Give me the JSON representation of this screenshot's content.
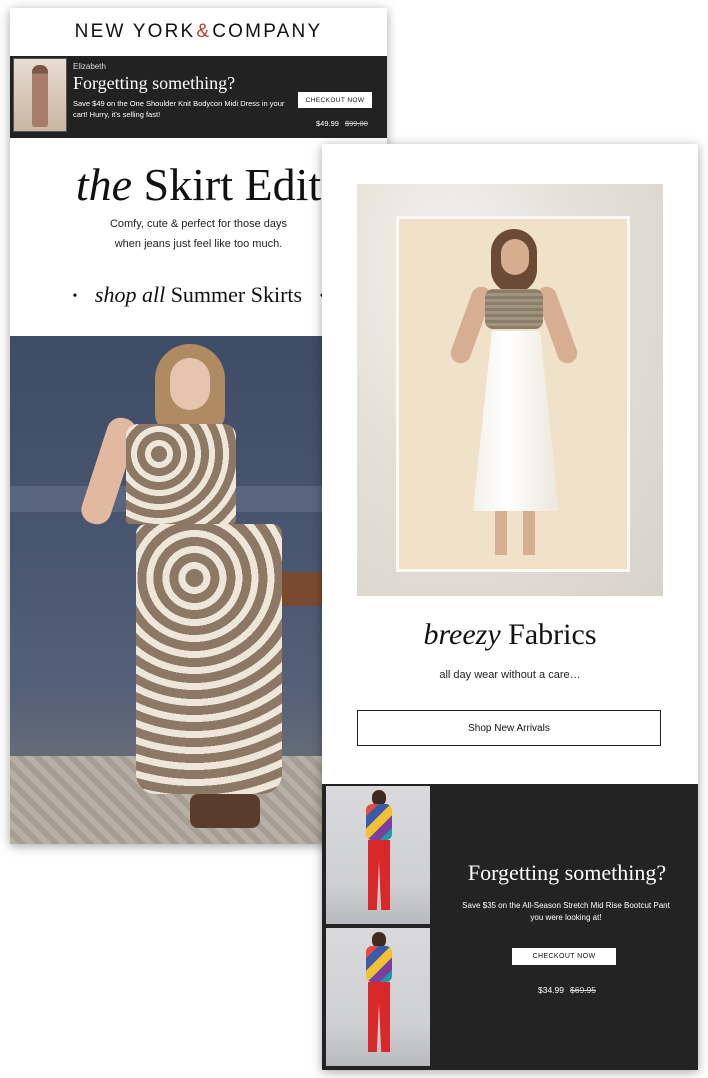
{
  "left_email": {
    "brand": {
      "part1": "NEW YORK",
      "amp": "&",
      "part2": "COMPANY"
    },
    "cart_banner": {
      "name": "Elizabeth",
      "title": "Forgetting something?",
      "description": "Save $49 on the One Shoulder Knit Bodycon Midi Dress in your cart! Hurry, it's selling fast!",
      "button": "CHECKOUT NOW",
      "price": "$49.99",
      "original_price": "$99.00"
    },
    "headline": {
      "italic": "the",
      "rest": "Skirt Edit"
    },
    "subheadline_line1": "Comfy, cute & perfect for those days",
    "subheadline_line2": "when jeans just feel like too much.",
    "shop_link": {
      "dot": "•",
      "italic": "shop all",
      "rest": "Summer Skirts"
    }
  },
  "right_email": {
    "headline": {
      "italic": "breezy",
      "rest": "Fabrics"
    },
    "subheadline": "all day wear without a care…",
    "button": "Shop New Arrivals",
    "bottom_banner": {
      "title": "Forgetting something?",
      "description": "Save $35 on the All-Season Stretch Mid Rise Bootcut Pant you were looking at!",
      "button": "CHECKOUT NOW",
      "price": "$34.99",
      "original_price": "$69.95"
    }
  },
  "colors": {
    "accent_amp": "#c0392b",
    "dark_banner": "#222222"
  }
}
